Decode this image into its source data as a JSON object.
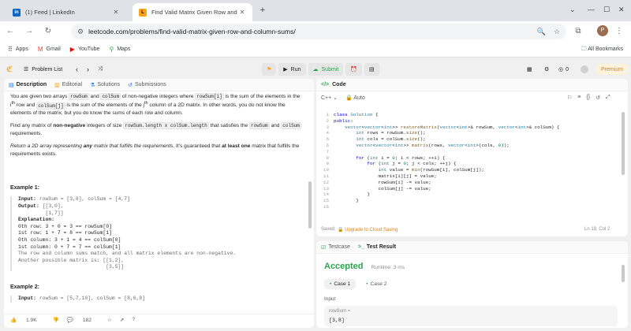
{
  "browser": {
    "tabs": [
      {
        "title": "(1) Feed | LinkedIn",
        "favicon": "in",
        "active": false
      },
      {
        "title": "Find Valid Matrix Given Row and Column Sums",
        "active": true
      }
    ],
    "url": "leetcode.com/problems/find-valid-matrix-given-row-and-column-sums/",
    "profile_initial": "P",
    "bookmarks": [
      {
        "label": "Apps",
        "icon": "apps-grid-icon"
      },
      {
        "label": "Gmail",
        "icon": "gmail-icon"
      },
      {
        "label": "YouTube",
        "icon": "youtube-icon"
      },
      {
        "label": "Maps",
        "icon": "maps-pin-icon"
      }
    ],
    "all_bookmarks_label": "All Bookmarks"
  },
  "header": {
    "problem_list_label": "Problem List",
    "run_label": "Run",
    "submit_label": "Submit",
    "coins": "0",
    "premium_label": "Premium"
  },
  "left_tabs": [
    "Description",
    "Editorial",
    "Solutions",
    "Submissions"
  ],
  "description": {
    "p1_a": "You are given two arrays ",
    "p1_code1": "rowSum",
    "p1_b": " and ",
    "p1_code2": "colSum",
    "p1_c": " of non-negative integers where ",
    "p1_code3": "rowSum[i]",
    "p1_d": " is the sum of the elements in the i",
    "p1_sup1": "th",
    "p1_e": " row and ",
    "p1_code4": "colSum[j]",
    "p1_f": " is the sum of the elements of the j",
    "p1_sup2": "th",
    "p1_g": " column of a 2D matrix. In other words, you do not know the elements of the matrix, but you do know the sums of each row and column.",
    "p2_a": "Find any matrix of ",
    "p2_bold": "non-negative",
    "p2_b": " integers of size ",
    "p2_code1": "rowSum.length x colSum.length",
    "p2_c": " that satisfies the ",
    "p2_code2": "rowSum",
    "p2_d": " and ",
    "p2_code3": "colSum",
    "p2_e": " requirements.",
    "p3_a": "Return a 2D array representing ",
    "p3_bold": "any",
    "p3_b": " matrix that fulfills the requirements",
    "p3_c": ". It's guaranteed that ",
    "p3_bold2": "at least one",
    "p3_d": " matrix that fulfills the requirements exists.",
    "example1_title": "Example 1:",
    "example1_input_label": "Input:",
    "example1_input": " rowSum = [3,8], colSum = [4,7]",
    "example1_output_label": "Output:",
    "example1_output_1": " [[3,0],",
    "example1_output_2": "         [1,7]]",
    "example1_expl_label": "Explanation:",
    "example1_e1": "0th row: 3 + 0 = 3 == rowSum[0]",
    "example1_e2": "1st row: 1 + 7 = 8 == rowSum[1]",
    "example1_e3": "0th column: 3 + 1 = 4 == colSum[0]",
    "example1_e4": "1st column: 0 + 7 = 7 == colSum[1]",
    "example1_e5": "The row and column sums match, and all matrix elements are non-negative.",
    "example1_e6": "Another possible matrix is: [[1,2],",
    "example1_e7": "                             [3,5]]",
    "example2_title": "Example 2:",
    "example2_input_label": "Input:",
    "example2_input": " rowSum = [5,7,10], colSum = [8,6,8]"
  },
  "left_status": {
    "likes": "1.9K",
    "comments": "182"
  },
  "code_panel": {
    "title": "Code",
    "language": "C++",
    "mode": "Auto",
    "lines": [
      "class Solution {",
      "public:",
      "    vector<vector<int>> restoreMatrix(vector<int>& rowSum, vector<int>& colSum) {",
      "        int rows = rowSum.size();",
      "        int cols = colSum.size();",
      "        vector<vector<int>> matrix(rows, vector<int>(cols, 0));",
      "",
      "        for (int i = 0; i < rows; ++i) {",
      "            for (int j = 0; j < cols; ++j) {",
      "                int value = min(rowSum[i], colSum[j]);",
      "                matrix[i][j] = value;",
      "                rowSum[i] -= value;",
      "                colSum[j] -= value;",
      "            }",
      "        }",
      ""
    ],
    "line_numbers": [
      "1",
      "2",
      "3",
      "4",
      "5",
      "6",
      "7",
      "8",
      "9",
      "10",
      "11",
      "12",
      "13",
      "14",
      "15",
      "16"
    ],
    "saved_label": "Saved",
    "upgrade_label": "Upgrade to Cloud Saving",
    "cursor_pos": "Ln 19, Col 2"
  },
  "result_panel": {
    "tabs": [
      "Testcase",
      "Test Result"
    ],
    "status": "Accepted",
    "runtime": "Runtime: 3 ms",
    "cases": [
      "Case 1",
      "Case 2"
    ],
    "input_label": "Input",
    "param_name": "rowSum =",
    "param_value": "[3,8]"
  },
  "colors": {
    "accepted": "#2da44e",
    "accent": "#ffa116",
    "premium": "#d9831f"
  }
}
